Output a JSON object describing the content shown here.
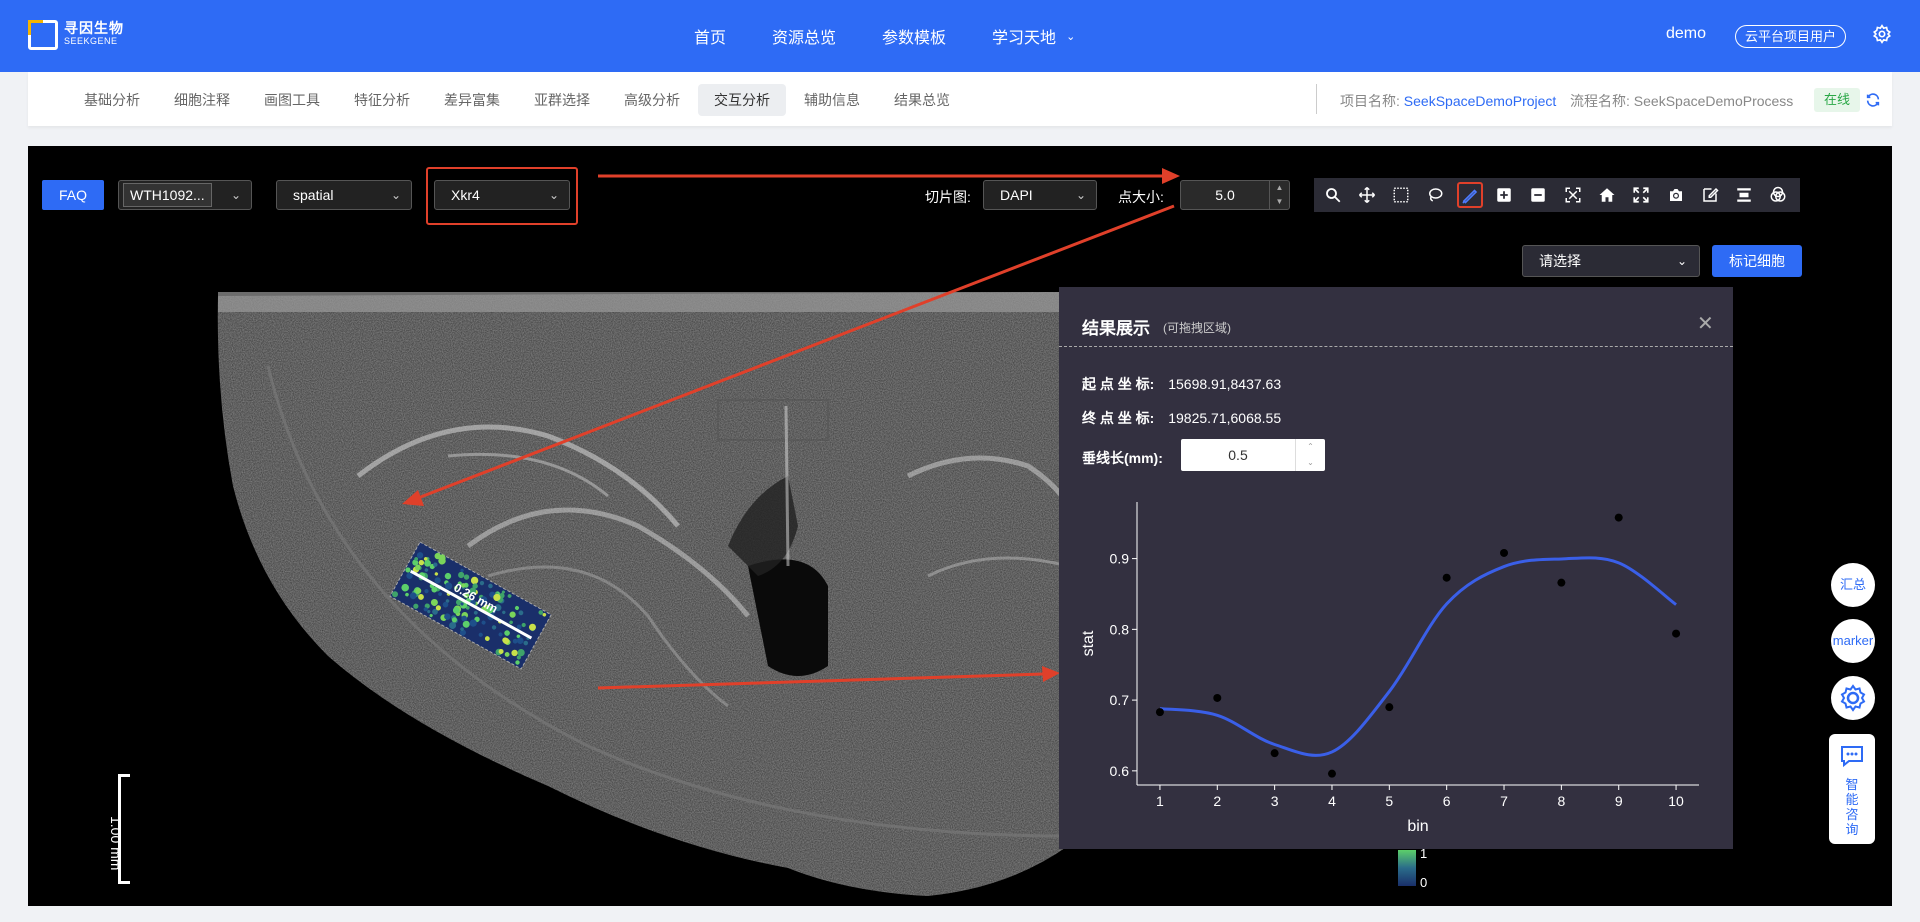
{
  "topnav": {
    "logo_cn": "寻因生物",
    "logo_en": "SEEKGENE",
    "items": [
      "首页",
      "资源总览",
      "参数模板",
      "学习天地"
    ],
    "user": "demo",
    "role": "云平台项目用户"
  },
  "subnav": {
    "tabs": [
      "基础分析",
      "细胞注释",
      "画图工具",
      "特征分析",
      "差异富集",
      "亚群选择",
      "高级分析",
      "交互分析",
      "辅助信息",
      "结果总览"
    ],
    "active_tab": "交互分析",
    "project_label": "项目名称:",
    "project_value": "SeekSpaceDemoProject",
    "flow_label": "流程名称:",
    "flow_value": "SeekSpaceDemoProcess",
    "status": "在线"
  },
  "toolbar": {
    "faq": "FAQ",
    "sample": "WTH1092...",
    "embedding": "spatial",
    "gene": "Xkr4",
    "slice_label": "切片图:",
    "slice_value": "DAPI",
    "point_size_label": "点大小:",
    "point_size_value": "5.0",
    "select_placeholder": "请选择",
    "mark_button": "标记细胞"
  },
  "canvas": {
    "scale_label": "1.00 mm",
    "colorbar_max": "1",
    "colorbar_min": "0",
    "roi_label": "0.26 mm"
  },
  "side_buttons": {
    "summary": "汇总",
    "marker": "marker",
    "chat": "智能咨询"
  },
  "result": {
    "title": "结果展示",
    "subtitle": "(可拖拽区域)",
    "start_label": "起 点 坐 标:",
    "start_value": "15698.91,8437.63",
    "end_label": "终 点 坐 标:",
    "end_value": "19825.71,6068.55",
    "perp_label": "垂线长(mm):",
    "perp_value": "0.5"
  },
  "chart_data": {
    "type": "line",
    "x": [
      1,
      2,
      3,
      4,
      5,
      6,
      7,
      8,
      9,
      10
    ],
    "y": [
      0.683,
      0.703,
      0.625,
      0.596,
      0.69,
      0.873,
      0.908,
      0.866,
      0.958,
      0.794
    ],
    "xlabel": "bin",
    "ylabel": "stat",
    "xlim": [
      0.6,
      10.4
    ],
    "ylim": [
      0.58,
      0.98
    ],
    "yticks": [
      0.6,
      0.7,
      0.8,
      0.9
    ],
    "line_color": "#3a5fe8",
    "point_color": "#000000",
    "smooth": true
  },
  "colors": {
    "brand": "#2e6bf5",
    "annotation": "#e0402a"
  }
}
